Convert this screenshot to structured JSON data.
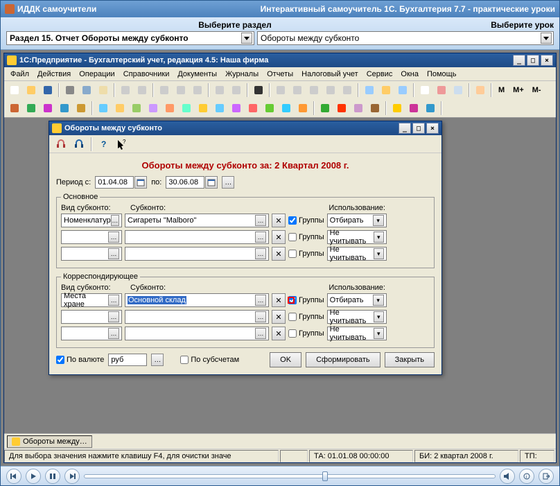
{
  "outer": {
    "title_left": "ИДДК самоучители",
    "title_right": "Интерактивный самоучитель 1С. Бухгалтерия 7.7 - практические уроки",
    "label_section": "Выберите раздел",
    "label_lesson": "Выберите урок",
    "combo_section": "Раздел 15. Отчет Обороты между субконто",
    "combo_lesson": "Обороты между субконто"
  },
  "inner": {
    "title": "1С:Предприятие - Бухгалтерский учет, редакция 4.5: Наша фирма",
    "menu": [
      "Файл",
      "Действия",
      "Операции",
      "Справочники",
      "Документы",
      "Журналы",
      "Отчеты",
      "Налоговый учет",
      "Сервис",
      "Окна",
      "Помощь"
    ],
    "txtbtns": [
      "М",
      "М+",
      "М-"
    ],
    "task_label": "Обороты между…",
    "status": {
      "hint": "Для выбора значения нажмите клавишу F4, для очистки значе",
      "ta": "ТА: 01.01.08  00:00:00",
      "bi": "БИ: 2 квартал 2008 г.",
      "tp": "ТП:"
    }
  },
  "dialog": {
    "title": "Обороты между субконто",
    "heading": "Обороты между субконто за: 2 Квартал 2008 г.",
    "period_label": "Период с:",
    "date_from": "01.04.08",
    "to_label": "по:",
    "date_to": "30.06.08",
    "main_legend": "Основное",
    "corr_legend": "Корреспондирующее",
    "col_vid": "Вид субконто:",
    "col_sub": "Субконто:",
    "col_use": "Использование:",
    "main_rows": [
      {
        "vid": "Номенклатур",
        "sub": "Сигареты \"Malboro\"",
        "grp": true,
        "use": "Отбирать"
      },
      {
        "vid": "",
        "sub": "",
        "grp": false,
        "use": "Не учитывать"
      },
      {
        "vid": "",
        "sub": "",
        "grp": false,
        "use": "Не учитывать"
      }
    ],
    "corr_rows": [
      {
        "vid": "Места хране",
        "sub": "Основной склад",
        "grp": true,
        "use": "Отбирать",
        "selected": true,
        "marker": true
      },
      {
        "vid": "",
        "sub": "",
        "grp": false,
        "use": "Не учитывать"
      },
      {
        "vid": "",
        "sub": "",
        "grp": false,
        "use": "Не учитывать"
      }
    ],
    "grp_label": "Группы",
    "by_currency": {
      "checked": true,
      "label": "По валюте",
      "value": "руб"
    },
    "by_subacc": {
      "checked": false,
      "label": "По субсчетам"
    },
    "btn_ok": "OK",
    "btn_form": "Сформировать",
    "btn_close": "Закрыть"
  }
}
